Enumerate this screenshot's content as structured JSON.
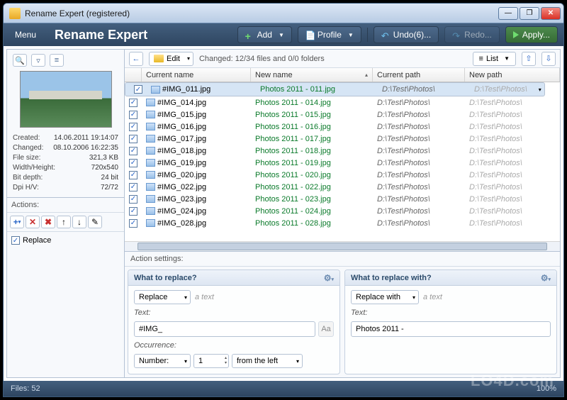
{
  "window": {
    "title": "Rename Expert (registered)"
  },
  "menu": {
    "label": "Menu"
  },
  "brand": "Rename Expert",
  "toolbar": {
    "add": "Add",
    "profile": "Profile",
    "undo": "Undo(6)...",
    "redo": "Redo...",
    "apply": "Apply..."
  },
  "listbar": {
    "edit": "Edit",
    "changed_label": "Changed:",
    "changed_value": "12/34 files and 0/0 folders",
    "list": "List"
  },
  "columns": {
    "current_name": "Current name",
    "new_name": "New name",
    "current_path": "Current path",
    "new_path": "New path"
  },
  "rows": [
    {
      "cur": "#IMG_011.jpg",
      "new": "Photos 2011 - 011.jpg",
      "cp": "D:\\Test\\Photos\\",
      "np": "D:\\Test\\Photos\\"
    },
    {
      "cur": "#IMG_014.jpg",
      "new": "Photos 2011 - 014.jpg",
      "cp": "D:\\Test\\Photos\\",
      "np": "D:\\Test\\Photos\\"
    },
    {
      "cur": "#IMG_015.jpg",
      "new": "Photos 2011 - 015.jpg",
      "cp": "D:\\Test\\Photos\\",
      "np": "D:\\Test\\Photos\\"
    },
    {
      "cur": "#IMG_016.jpg",
      "new": "Photos 2011 - 016.jpg",
      "cp": "D:\\Test\\Photos\\",
      "np": "D:\\Test\\Photos\\"
    },
    {
      "cur": "#IMG_017.jpg",
      "new": "Photos 2011 - 017.jpg",
      "cp": "D:\\Test\\Photos\\",
      "np": "D:\\Test\\Photos\\"
    },
    {
      "cur": "#IMG_018.jpg",
      "new": "Photos 2011 - 018.jpg",
      "cp": "D:\\Test\\Photos\\",
      "np": "D:\\Test\\Photos\\"
    },
    {
      "cur": "#IMG_019.jpg",
      "new": "Photos 2011 - 019.jpg",
      "cp": "D:\\Test\\Photos\\",
      "np": "D:\\Test\\Photos\\"
    },
    {
      "cur": "#IMG_020.jpg",
      "new": "Photos 2011 - 020.jpg",
      "cp": "D:\\Test\\Photos\\",
      "np": "D:\\Test\\Photos\\"
    },
    {
      "cur": "#IMG_022.jpg",
      "new": "Photos 2011 - 022.jpg",
      "cp": "D:\\Test\\Photos\\",
      "np": "D:\\Test\\Photos\\"
    },
    {
      "cur": "#IMG_023.jpg",
      "new": "Photos 2011 - 023.jpg",
      "cp": "D:\\Test\\Photos\\",
      "np": "D:\\Test\\Photos\\"
    },
    {
      "cur": "#IMG_024.jpg",
      "new": "Photos 2011 - 024.jpg",
      "cp": "D:\\Test\\Photos\\",
      "np": "D:\\Test\\Photos\\"
    },
    {
      "cur": "#IMG_028.jpg",
      "new": "Photos 2011 - 028.jpg",
      "cp": "D:\\Test\\Photos\\",
      "np": "D:\\Test\\Photos\\"
    }
  ],
  "meta": {
    "created_k": "Created:",
    "created_v": "14.06.2011 19:14:07",
    "changed_k": "Changed:",
    "changed_v": "08.10.2006 16:22:35",
    "size_k": "File size:",
    "size_v": "321,3 KB",
    "dim_k": "Width/Height:",
    "dim_v": "720x540",
    "depth_k": "Bit depth:",
    "depth_v": "24 bit",
    "dpi_k": "Dpi H/V:",
    "dpi_v": "72/72"
  },
  "actions": {
    "header": "Actions:",
    "item": "Replace"
  },
  "settings": {
    "header": "Action settings:",
    "left": {
      "title": "What to replace?",
      "mode": "Replace",
      "mode_hint": "a text",
      "text_lbl": "Text:",
      "text_val": "#IMG_",
      "occ_lbl": "Occurrence:",
      "occ_mode": "Number:",
      "occ_num": "1",
      "occ_from": "from the left"
    },
    "right": {
      "title": "What to replace with?",
      "mode": "Replace with",
      "mode_hint": "a text",
      "text_lbl": "Text:",
      "text_val": "Photos 2011 - "
    }
  },
  "status": {
    "files": "Files: 52",
    "right": "100%"
  },
  "watermark": "LO4D.com"
}
